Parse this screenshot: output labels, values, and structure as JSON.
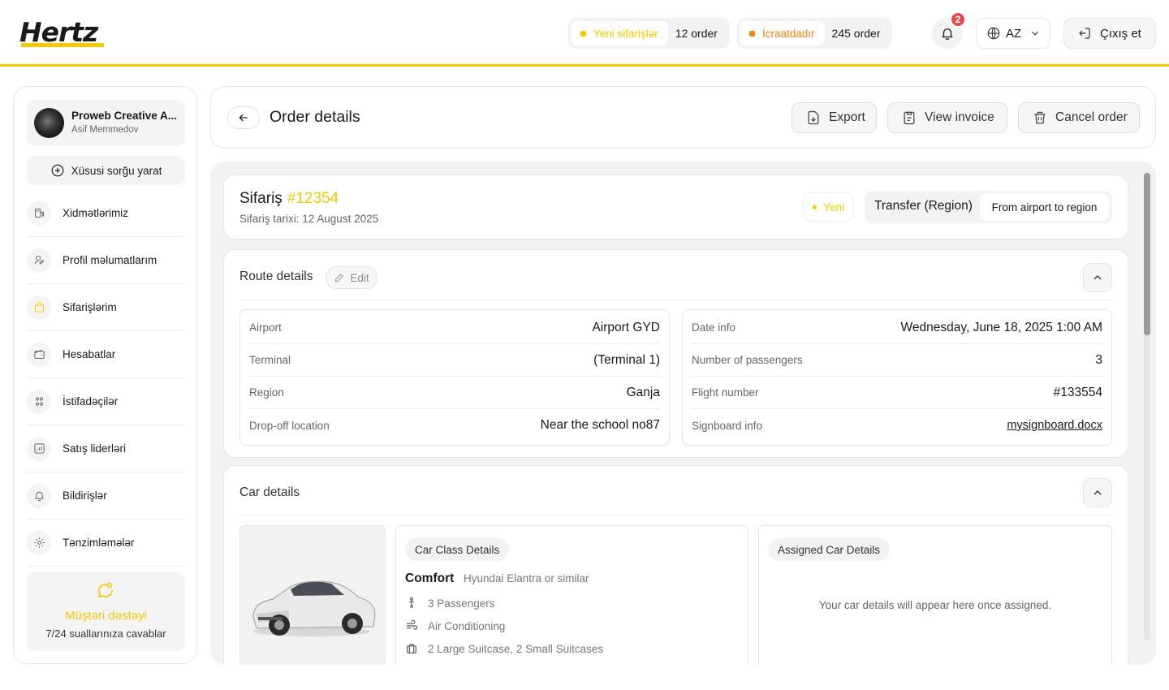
{
  "brand": {
    "logo_text": "Hertz",
    "accent": "#f5c800"
  },
  "header": {
    "new_orders": {
      "label": "Yeni sifarişlər",
      "count": "12 order",
      "color": "#f5c800"
    },
    "in_progress": {
      "label": "İcraatdadır",
      "count": "245 order",
      "color": "#f5820d"
    },
    "notifications_count": "2",
    "language": "AZ",
    "logout_label": "Çıxış et"
  },
  "sidebar": {
    "profile": {
      "name": "Proweb Creative A...",
      "user": "Asif Memmedov"
    },
    "special_request_label": "Xüsusi sorğu yarat",
    "items": [
      {
        "label": "Xidmətlərimiz",
        "icon": "fuel-icon"
      },
      {
        "label": "Profil məlumatlarım",
        "icon": "user-edit-icon"
      },
      {
        "label": "Sifarişlərim",
        "icon": "bag-icon"
      },
      {
        "label": "Hesabatlar",
        "icon": "wallet-icon"
      },
      {
        "label": "İstifadəçilər",
        "icon": "users-icon"
      },
      {
        "label": "Satış liderləri",
        "icon": "chart-icon"
      },
      {
        "label": "Bildirişlər",
        "icon": "bell-icon"
      },
      {
        "label": "Tənzimləmələr",
        "icon": "gear-icon"
      }
    ],
    "support": {
      "title": "Müştəri dəstəyi",
      "subtitle": "7/24 suallarınıza cavablar"
    }
  },
  "page": {
    "title": "Order details",
    "actions": {
      "export": "Export",
      "invoice": "View invoice",
      "cancel": "Cancel order"
    }
  },
  "order": {
    "title_prefix": "Sifariş",
    "number": "#12354",
    "date_label": "Sifariş tarixi: 12 August 2025",
    "status": "Yeni",
    "transfer_type": "Transfer (Region)",
    "transfer_direction": "From airport to region"
  },
  "route": {
    "title": "Route details",
    "edit_label": "Edit",
    "left": [
      {
        "k": "Airport",
        "v": "Airport GYD"
      },
      {
        "k": "Terminal",
        "v": "(Terminal 1)"
      },
      {
        "k": "Region",
        "v": "Ganja"
      },
      {
        "k": "Drop-off location",
        "v": "Near the school no87"
      }
    ],
    "right": [
      {
        "k": "Date info",
        "v": "Wednesday, June 18, 2025 1:00 AM"
      },
      {
        "k": "Number of passengers",
        "v": "3"
      },
      {
        "k": "Flight number",
        "v": "#133554"
      },
      {
        "k": "Signboard info",
        "v": "mysignboard.docx"
      }
    ]
  },
  "car": {
    "title": "Car details",
    "class_chip": "Car Class Details",
    "class_name": "Comfort",
    "class_model": "Hyundai Elantra or similar",
    "features": [
      "3 Passengers",
      "Air Conditioning",
      "2 Large Suitcase, 2 Small Suitcases"
    ],
    "assigned_chip": "Assigned Car Details",
    "assigned_message": "Your car details will appear here once assigned."
  }
}
